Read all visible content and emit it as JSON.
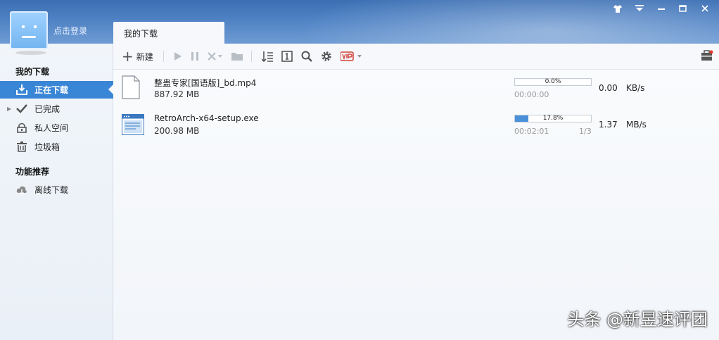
{
  "user": {
    "login_label": "点击登录"
  },
  "tab": {
    "label": "我的下载"
  },
  "window_controls": {
    "skin": "skin-icon",
    "menu": "menu-icon",
    "minimize": "–",
    "maximize": "□",
    "close": "✕"
  },
  "sidebar": {
    "section1_title": "我的下载",
    "items": [
      {
        "label": "正在下载",
        "icon": "download-icon",
        "active": true
      },
      {
        "label": "已完成",
        "icon": "check-icon",
        "active": false
      },
      {
        "label": "私人空间",
        "icon": "lock-icon",
        "active": false
      },
      {
        "label": "垃圾箱",
        "icon": "trash-icon",
        "active": false
      }
    ],
    "section2_title": "功能推荐",
    "items2": [
      {
        "label": "离线下载",
        "icon": "cloud-download-icon"
      }
    ]
  },
  "toolbar": {
    "new_label": "新建",
    "buttons": [
      "play-icon",
      "pause-icon",
      "delete-icon",
      "folder-icon",
      "sort-icon",
      "number-icon",
      "search-icon",
      "gear-icon",
      "vip-icon"
    ],
    "right": "toolbox-icon"
  },
  "downloads": [
    {
      "name": "整蛊专家[国语版]_bd.mp4",
      "size": "887.92 MB",
      "progress_pct": "0.0%",
      "progress": 0.0,
      "time": "00:00:00",
      "parts": "",
      "speed": "0.00",
      "unit": "KB/s",
      "icon": "file-icon"
    },
    {
      "name": "RetroArch-x64-setup.exe",
      "size": "200.98 MB",
      "progress_pct": "17.8%",
      "progress": 0.178,
      "time": "00:02:01",
      "parts": "1/3",
      "speed": "1.37",
      "unit": "MB/s",
      "icon": "app-window-icon"
    }
  ],
  "watermark": "头条 @新昱速评团"
}
